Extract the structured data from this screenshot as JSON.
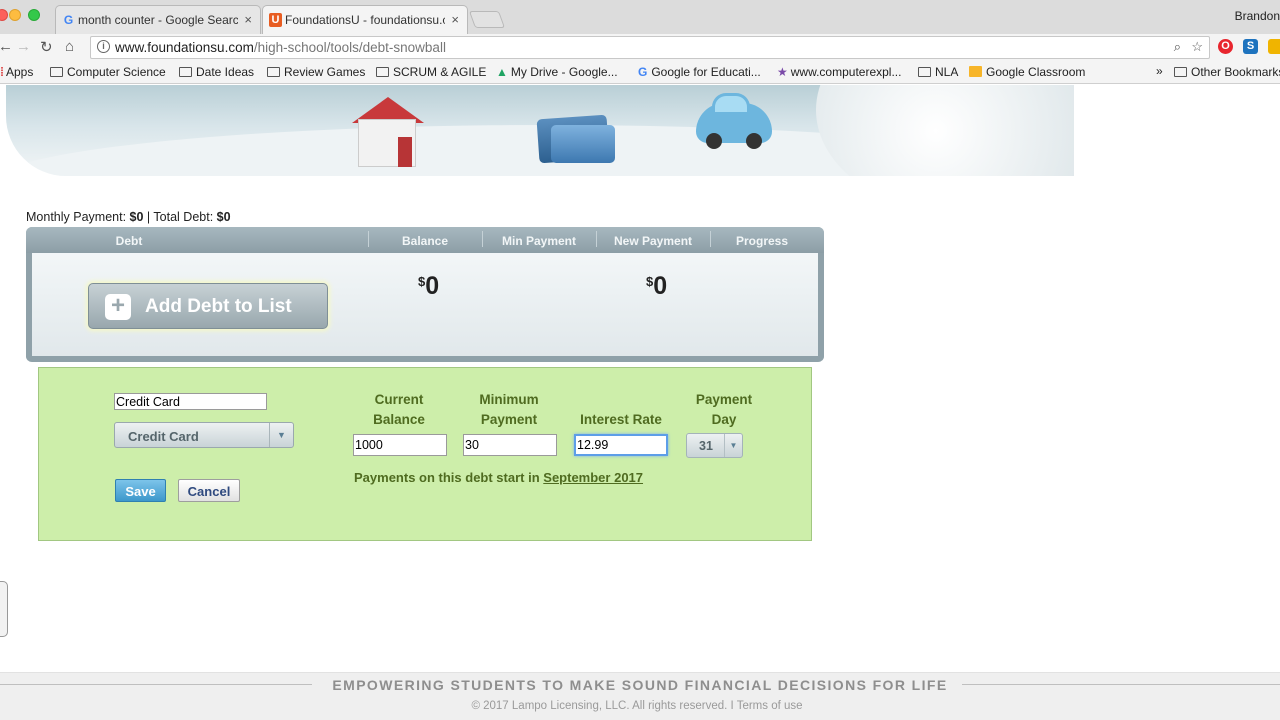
{
  "browser": {
    "tabs": [
      {
        "title": "month counter - Google Searc",
        "active": false
      },
      {
        "title": "FoundationsU - foundationsu.c",
        "active": true
      }
    ],
    "profile_name": "Brandon",
    "close_glyph": "×",
    "url_host": "www.foundationsu.com",
    "url_path": "/high-school/tools/debt-snowball",
    "bookmarks": [
      "Apps",
      "Computer Science",
      "Date Ideas",
      "Review Games",
      "SCRUM & AGILE",
      "My Drive - Google...",
      "Google for Educati...",
      "www.computerexpl...",
      "NLA",
      "Google Classroom"
    ],
    "bookmarks_overflow": "»",
    "other_bookmarks": "Other Bookmarks"
  },
  "summary": {
    "monthly_label": "Monthly Payment:",
    "monthly_value": "$0",
    "separator": "|",
    "total_label": "Total Debt:",
    "total_value": "$0"
  },
  "table": {
    "columns": [
      "Debt",
      "Balance",
      "Min Payment",
      "New Payment",
      "Progress"
    ],
    "add_button": "Add Debt to List",
    "balance_total_symbol": "$",
    "balance_total": "0",
    "new_payment_total_symbol": "$",
    "new_payment_total": "0"
  },
  "form": {
    "name_value": "Credit Card",
    "type_selected": "Credit Card",
    "current_balance_label": [
      "Current",
      "Balance"
    ],
    "minimum_payment_label": [
      "Minimum",
      "Payment"
    ],
    "interest_rate_label": "Interest Rate",
    "payment_day_label": [
      "Payment",
      "Day"
    ],
    "balance_value": "1000",
    "min_payment_value": "30",
    "interest_rate_value": "12.99",
    "payment_day_selected": "31",
    "start_note": "Payments on this debt start in",
    "start_month": "September 2017",
    "save_label": "Save",
    "cancel_label": "Cancel"
  },
  "footer": {
    "tagline": "EMPOWERING STUDENTS TO MAKE SOUND FINANCIAL DECISIONS FOR LIFE",
    "copyright": "© 2017 Lampo Licensing, LLC. All rights reserved. I Terms of use"
  },
  "colors": {
    "form_background": "#cdeeaa",
    "form_label": "#4f6b20",
    "save_button": "#3d98cb",
    "table_header": "#8c9ea6"
  }
}
